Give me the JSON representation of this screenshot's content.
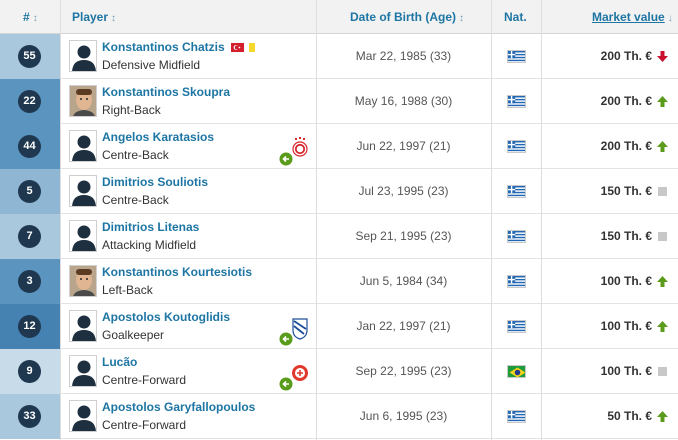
{
  "header": {
    "number": "#",
    "player": "Player",
    "dob": "Date of Birth (Age)",
    "nat": "Nat.",
    "market_value": "Market value",
    "sort_icon": "↕",
    "sort_desc_icon": "↓"
  },
  "colors": {
    "link": "#1d75a3",
    "number_badge": "#1f3850",
    "trend_up": "#5b9b1b",
    "trend_down": "#c8102e",
    "trend_flat": "#c8c8c8"
  },
  "rows": [
    {
      "number": "55",
      "name": "Konstantinos Chatzis",
      "position": "Defensive Midfield",
      "dob": "Mar 22, 1985 (33)",
      "nationality": "greece-flag",
      "value": "200 Th. €",
      "trend": "down",
      "portrait": "silhouette",
      "badges": [
        "turkey-flag-icon",
        "yellow-card-icon"
      ],
      "club": null,
      "num_bg": "#a9c8de"
    },
    {
      "number": "22",
      "name": "Konstantinos Skoupra",
      "position": "Right-Back",
      "dob": "May 16, 1988 (30)",
      "nationality": "greece-flag",
      "value": "200 Th. €",
      "trend": "up",
      "portrait": "photo",
      "badges": [],
      "club": null,
      "num_bg": "#5a94bf"
    },
    {
      "number": "44",
      "name": "Angelos Karatasios",
      "position": "Centre-Back",
      "dob": "Jun 22, 1997 (21)",
      "nationality": "greece-flag",
      "value": "200 Th. €",
      "trend": "up",
      "portrait": "silhouette",
      "badges": [],
      "club": "olympiacos-red",
      "num_bg": "#5a94bf"
    },
    {
      "number": "5",
      "name": "Dimitrios Souliotis",
      "position": "Centre-Back",
      "dob": "Jul 23, 1995 (23)",
      "nationality": "greece-flag",
      "value": "150 Th. €",
      "trend": "flat",
      "portrait": "silhouette",
      "badges": [],
      "club": null,
      "num_bg": "#8fb7d4"
    },
    {
      "number": "7",
      "name": "Dimitrios Litenas",
      "position": "Attacking Midfield",
      "dob": "Sep 21, 1995 (23)",
      "nationality": "greece-flag",
      "value": "150 Th. €",
      "trend": "flat",
      "portrait": "silhouette",
      "badges": [],
      "club": null,
      "num_bg": "#a9c8de"
    },
    {
      "number": "3",
      "name": "Konstantinos Kourtesiotis",
      "position": "Left-Back",
      "dob": "Jun 5, 1984 (34)",
      "nationality": "greece-flag",
      "value": "100 Th. €",
      "trend": "up",
      "portrait": "photo",
      "badges": [],
      "club": null,
      "num_bg": "#5a94bf"
    },
    {
      "number": "12",
      "name": "Apostolos Koutoglidis",
      "position": "Goalkeeper",
      "dob": "Jan 22, 1997 (21)",
      "nationality": "greece-flag",
      "value": "100 Th. €",
      "trend": "up",
      "portrait": "silhouette",
      "badges": [],
      "club": "blue-white-crest",
      "num_bg": "#4582b2"
    },
    {
      "number": "9",
      "name": "Lucão",
      "position": "Centre-Forward",
      "dob": "Sep 22, 1995 (23)",
      "nationality": "brazil-flag",
      "value": "100 Th. €",
      "trend": "flat",
      "portrait": "silhouette",
      "badges": [],
      "club": "red-crest",
      "num_bg": "#c7dbe9"
    },
    {
      "number": "33",
      "name": "Apostolos Garyfallopoulos",
      "position": "Centre-Forward",
      "dob": "Jun 6, 1995 (23)",
      "nationality": "greece-flag",
      "value": "50 Th. €",
      "trend": "up",
      "portrait": "silhouette",
      "badges": [],
      "club": null,
      "num_bg": "#a9c8de"
    }
  ]
}
